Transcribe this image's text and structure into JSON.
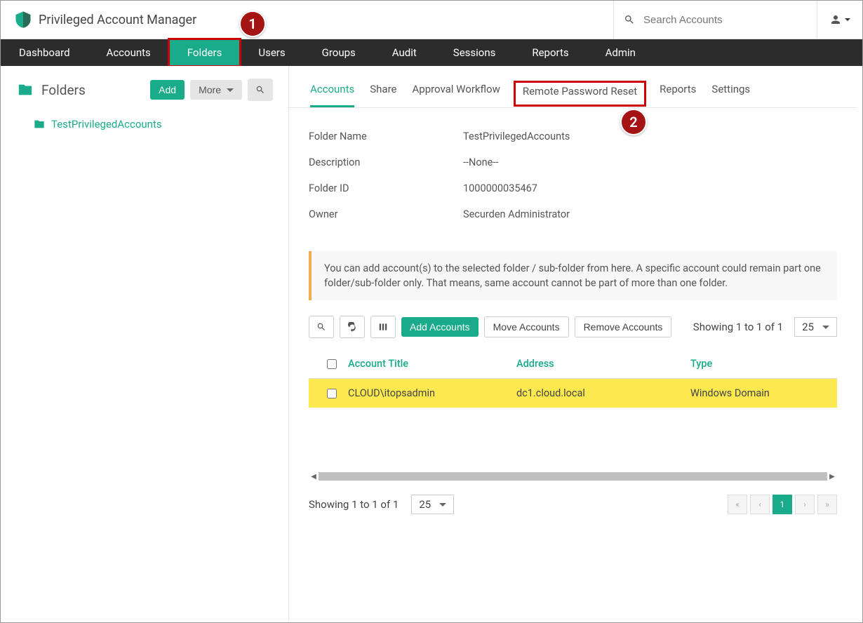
{
  "app_title": "Privileged Account Manager",
  "search": {
    "placeholder": "Search Accounts"
  },
  "nav": {
    "items": [
      "Dashboard",
      "Accounts",
      "Folders",
      "Users",
      "Groups",
      "Audit",
      "Sessions",
      "Reports",
      "Admin"
    ],
    "active_index": 2
  },
  "callouts": {
    "one": "1",
    "two": "2"
  },
  "sidebar": {
    "title": "Folders",
    "add_label": "Add",
    "more_label": "More",
    "tree": {
      "item0": "TestPrivilegedAccounts"
    }
  },
  "subtabs": {
    "items": [
      "Accounts",
      "Share",
      "Approval Workflow",
      "Remote Password Reset",
      "Reports",
      "Settings"
    ],
    "active_index": 0,
    "highlight_index": 3
  },
  "details": {
    "rows": [
      {
        "label": "Folder Name",
        "value": "TestPrivilegedAccounts"
      },
      {
        "label": "Description",
        "value": "--None--"
      },
      {
        "label": "Folder ID",
        "value": "1000000035467"
      },
      {
        "label": "Owner",
        "value": "Securden Administrator"
      }
    ]
  },
  "info_text": "You can add account(s) to the selected folder / sub-folder from here. A specific account could remain part one folder/sub-folder only. That means, same account cannot be part of more than one folder.",
  "toolbar": {
    "add_accounts": "Add Accounts",
    "move_accounts": "Move Accounts",
    "remove_accounts": "Remove Accounts",
    "showing": "Showing 1 to 1 of 1",
    "page_size": "25"
  },
  "table": {
    "columns": {
      "title": "Account Title",
      "address": "Address",
      "type": "Type"
    },
    "rows": [
      {
        "title": "CLOUD\\itopsadmin",
        "address": "dc1.cloud.local",
        "type": "Windows Domain"
      }
    ]
  },
  "footer": {
    "showing": "Showing 1 to 1 of 1",
    "page_size": "25",
    "current_page": "1"
  }
}
